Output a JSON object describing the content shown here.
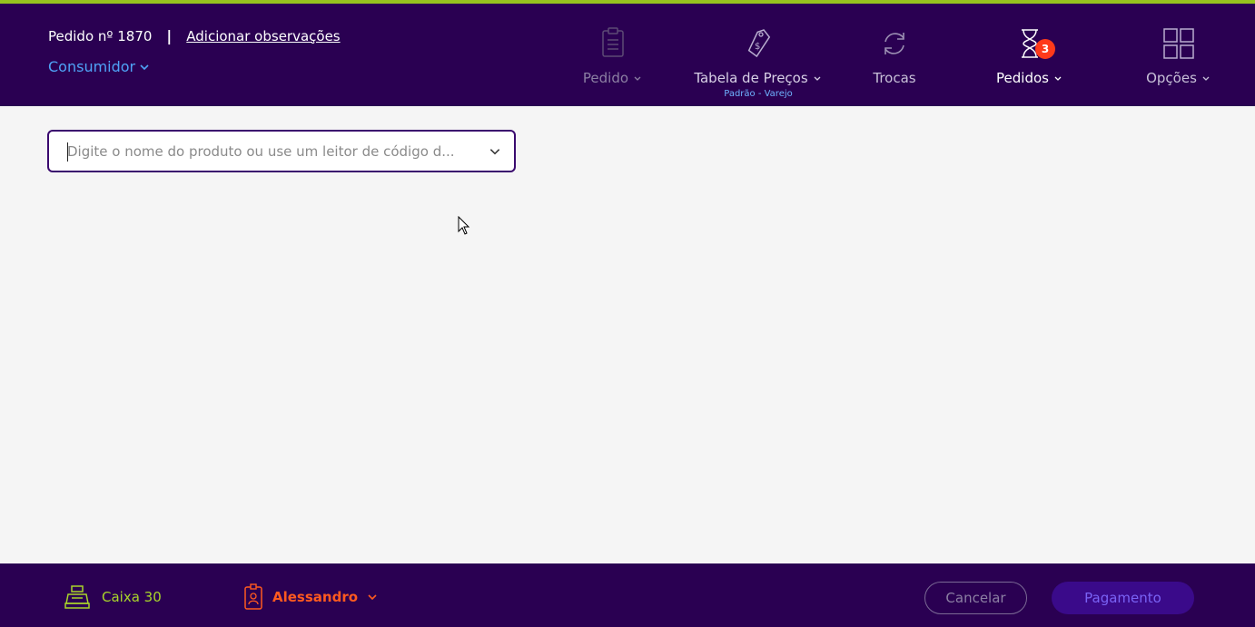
{
  "header": {
    "order_label": "Pedido nº 1870",
    "separator": "|",
    "notes_link": "Adicionar observações",
    "customer": "Consumidor"
  },
  "nav": {
    "order": {
      "label": "Pedido",
      "icon": "clipboard-icon"
    },
    "price_table": {
      "label": "Tabela de Preços",
      "sub": "Padrão - Varejo",
      "icon": "price-tag-icon"
    },
    "exchanges": {
      "label": "Trocas",
      "icon": "refresh-icon"
    },
    "orders": {
      "label": "Pedidos",
      "badge": "3",
      "icon": "hourglass-icon"
    },
    "options": {
      "label": "Opções",
      "icon": "grid-icon"
    }
  },
  "search": {
    "placeholder": "Digite o nome do produto ou use um leitor de código d...",
    "value": ""
  },
  "footer": {
    "register": "Caixa 30",
    "seller": "Alessandro",
    "cancel": "Cancelar",
    "payment": "Pagamento"
  },
  "colors": {
    "bar": "#2a0052",
    "accent_top": "#96c31e",
    "customer": "#4fa3f7",
    "badge": "#ff3a1a",
    "register": "#a9d62a",
    "seller": "#ff5a1f"
  }
}
